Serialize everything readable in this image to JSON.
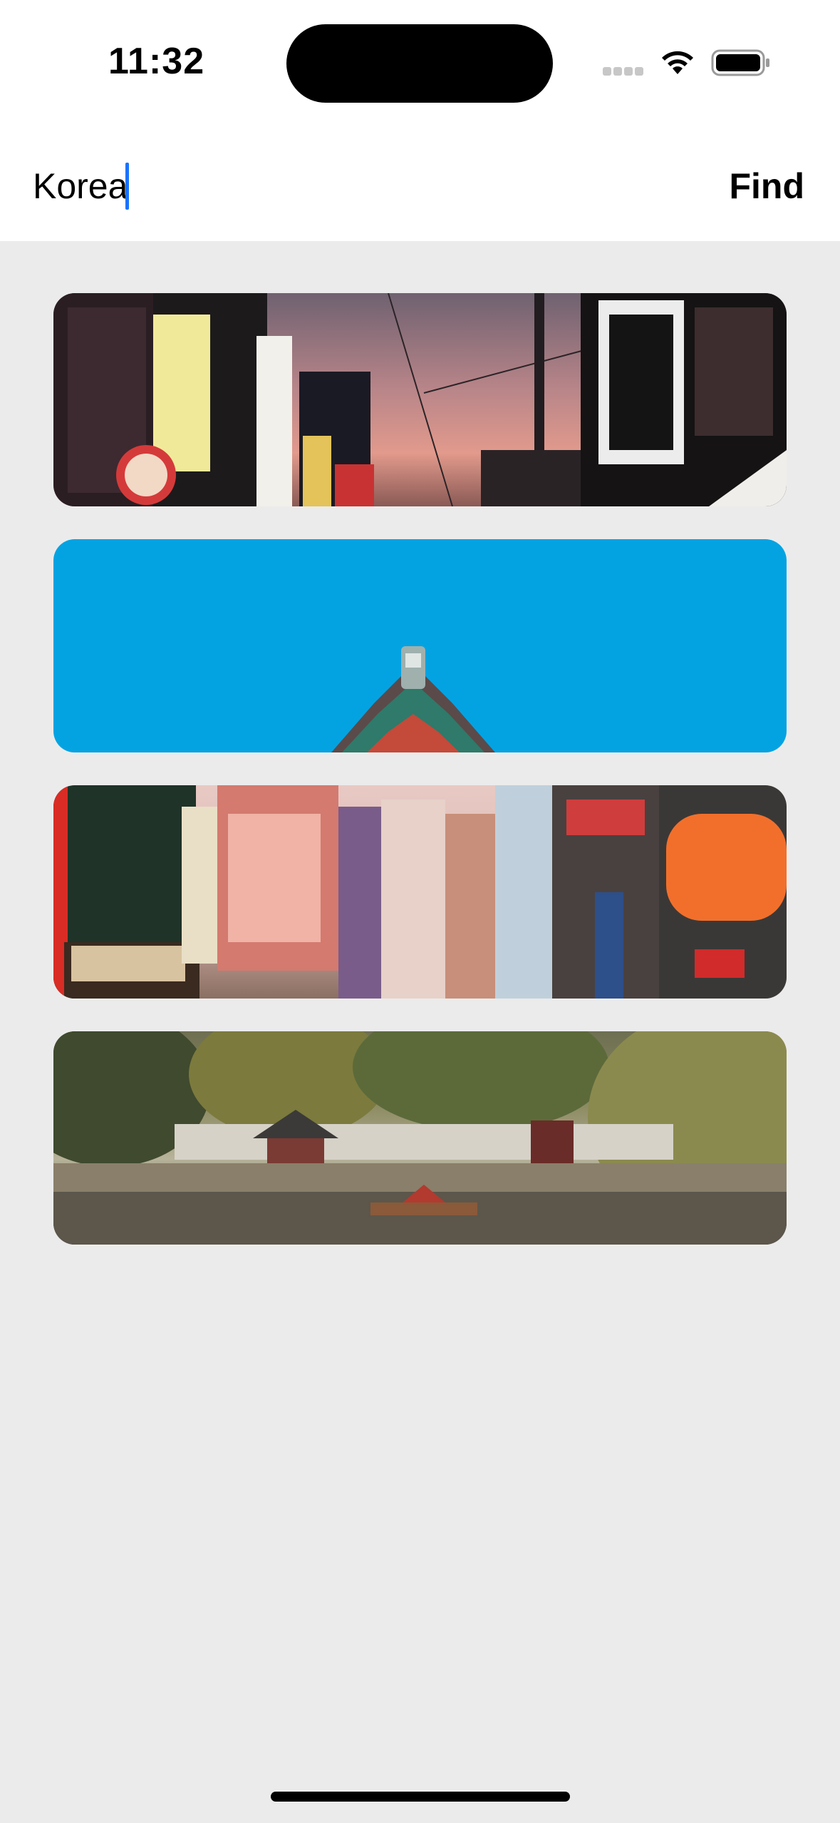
{
  "status_bar": {
    "time": "11:32"
  },
  "search": {
    "value": "Korea",
    "find_label": "Find"
  },
  "results": [
    {
      "name": "city-street-signs-dusk"
    },
    {
      "name": "palace-roof-blue-sky"
    },
    {
      "name": "shopping-street-billboards"
    },
    {
      "name": "pavilion-pond-trees"
    }
  ],
  "colors": {
    "page_background": "#ebebeb",
    "header_background": "#ffffff",
    "caret": "#1a73ff",
    "sky_blue": "#03a3e2"
  }
}
